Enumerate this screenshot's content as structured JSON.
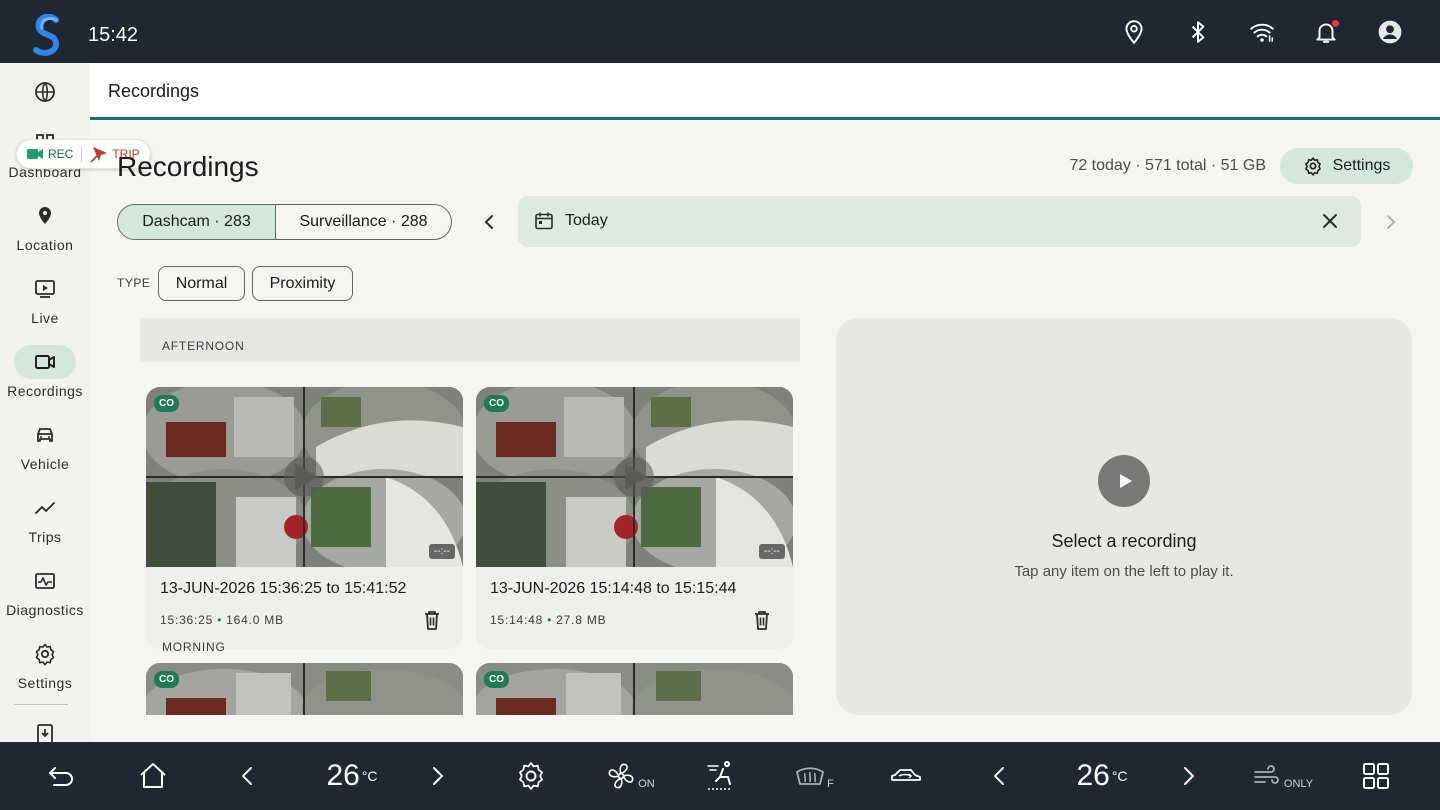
{
  "status_bar": {
    "time": "15:42"
  },
  "nav": {
    "items": [
      {
        "label": ""
      },
      {
        "label": "Dashboard"
      },
      {
        "label": "Location"
      },
      {
        "label": "Live"
      },
      {
        "label": "Recordings"
      },
      {
        "label": "Vehicle"
      },
      {
        "label": "Trips"
      },
      {
        "label": "Diagnostics"
      },
      {
        "label": "Settings"
      }
    ],
    "active": "Recordings"
  },
  "overlay_pill": {
    "rec": "REC",
    "trip": "TRIP"
  },
  "header": {
    "title": "Recordings"
  },
  "page": {
    "title": "Recordings",
    "stats": "72 today · 571 total · 51 GB",
    "settings_label": "Settings"
  },
  "segments": [
    {
      "label": "Dashcam · 283",
      "active": true
    },
    {
      "label": "Surveillance · 288",
      "active": false
    }
  ],
  "date_filter": {
    "value": "Today"
  },
  "type_filter": {
    "label": "TYPE",
    "chips": [
      "Normal",
      "Proximity"
    ]
  },
  "sections": [
    {
      "header": "AFTERNOON",
      "items": [
        {
          "badge": "CO",
          "duration": "--:--",
          "title": "13-JUN-2026 15:36:25 to 15:41:52",
          "time": "15:36:25",
          "size": "164.0 MB"
        },
        {
          "badge": "CO",
          "duration": "--:--",
          "title": "13-JUN-2026 15:14:48 to 15:15:44",
          "time": "15:14:48",
          "size": "27.8 MB"
        }
      ]
    },
    {
      "header": "MORNING",
      "items": [
        {
          "badge": "CO"
        },
        {
          "badge": "CO"
        }
      ]
    }
  ],
  "preview": {
    "title": "Select a recording",
    "subtitle": "Tap any item on the left to play it."
  },
  "climate": {
    "left_temp": "26",
    "right_temp": "26",
    "unit": "°C",
    "fan_state": "ON",
    "rear_defrost_label": "F",
    "airflow_label": "ONLY"
  },
  "colors": {
    "accent": "#17706a",
    "active_bg": "#d4e7dd",
    "bar_bg": "#1f2733",
    "badge": "#1f7a57"
  }
}
